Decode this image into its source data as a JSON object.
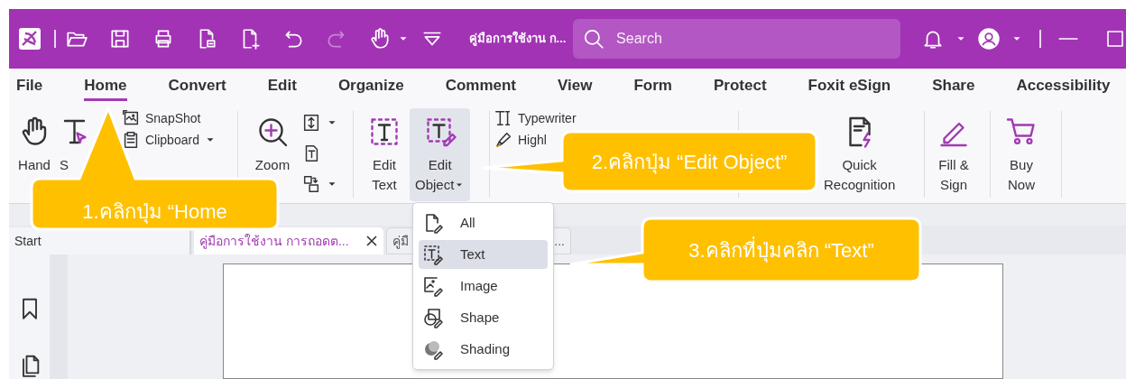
{
  "title_bar": {
    "quick_access": [
      {
        "kind": "logo",
        "disabled": false
      },
      {
        "kind": "open",
        "disabled": false
      },
      {
        "kind": "save",
        "disabled": false
      },
      {
        "kind": "print",
        "disabled": false
      },
      {
        "kind": "export",
        "disabled": false
      },
      {
        "kind": "new",
        "disabled": false
      },
      {
        "kind": "undo",
        "disabled": false
      },
      {
        "kind": "redo",
        "disabled": true
      },
      {
        "kind": "hand",
        "disabled": false
      },
      {
        "kind": "dropdown",
        "disabled": false
      },
      {
        "kind": "customize",
        "disabled": false
      }
    ],
    "document_title": "คู่มือการใช้งาน ก...",
    "search": {
      "placeholder": "Search"
    },
    "controls": [
      {
        "kind": "bell"
      },
      {
        "kind": "dropdown"
      },
      {
        "kind": "account"
      },
      {
        "kind": "dropdown"
      },
      {
        "kind": "separator"
      },
      {
        "kind": "minimize"
      },
      {
        "kind": "maximize"
      }
    ]
  },
  "menu": [
    {
      "label": "File",
      "selected": false
    },
    {
      "label": "Home",
      "selected": true
    },
    {
      "label": "Convert",
      "selected": false
    },
    {
      "label": "Edit",
      "selected": false
    },
    {
      "label": "Organize",
      "selected": false
    },
    {
      "label": "Comment",
      "selected": false
    },
    {
      "label": "View",
      "selected": false
    },
    {
      "label": "Form",
      "selected": false
    },
    {
      "label": "Protect",
      "selected": false
    },
    {
      "label": "Foxit eSign",
      "selected": false
    },
    {
      "label": "Share",
      "selected": false
    },
    {
      "label": "Accessibility",
      "selected": false
    }
  ],
  "ribbon": [
    {
      "tools": [
        {
          "kind": "hand",
          "lines": [
            "Hand"
          ],
          "dropdown": false,
          "selected": false
        },
        {
          "kind": "select",
          "lines": [
            "S"
          ],
          "dropdown": false,
          "selected": false
        },
        {
          "kind": "stack",
          "rows": [
            {
              "kind": "snapshot",
              "label": "SnapShot",
              "dropdown": false
            },
            {
              "kind": "clipboard",
              "label": "Clipboard",
              "dropdown": true
            }
          ]
        }
      ]
    },
    {
      "tools": [
        {
          "kind": "zoom",
          "lines": [
            "Zoom"
          ],
          "dropdown": false,
          "selected": false
        },
        {
          "kind": "stack",
          "rows": [
            {
              "kind": "fit-page",
              "dropdown": true
            },
            {
              "kind": "fit-width",
              "dropdown": false
            },
            {
              "kind": "rotate",
              "dropdown": true
            }
          ]
        }
      ]
    },
    {
      "tools": [
        {
          "kind": "edit-text",
          "lines": [
            "Edit",
            "Text"
          ],
          "dropdown": false,
          "selected": false
        },
        {
          "kind": "edit-object",
          "lines": [
            "Edit",
            "Object"
          ],
          "dropdown": true,
          "selected": true
        }
      ]
    },
    {
      "tools": [
        {
          "kind": "stack",
          "rows": [
            {
              "kind": "typewriter",
              "label": "Typewriter",
              "dropdown": false
            },
            {
              "kind": "highlight",
              "label": "Highl",
              "dropdown": false
            }
          ]
        }
      ]
    },
    {
      "tools": [
        {
          "kind": "ocr",
          "lines": [
            "Quick",
            "Recognition"
          ],
          "dropdown": false,
          "selected": false
        }
      ]
    },
    {
      "tools": [
        {
          "kind": "fill-sign",
          "lines": [
            "Fill &",
            "Sign"
          ],
          "dropdown": false,
          "selected": false
        }
      ]
    },
    {
      "tools": [
        {
          "kind": "cart",
          "lines": [
            "Buy",
            "Now"
          ],
          "dropdown": false,
          "selected": false
        }
      ]
    }
  ],
  "tabs": [
    {
      "label": "Start",
      "selected": false,
      "close": false
    },
    {
      "label": "คู่มือการใช้งาน การถอดต...",
      "selected": true,
      "close": true
    },
    {
      "label": "คู่มื",
      "tail": "...",
      "selected": false,
      "close": false
    }
  ],
  "sidebar": [
    {
      "kind": "bookmark"
    },
    {
      "kind": "pages"
    }
  ],
  "dropdown_menu": [
    {
      "kind": "all",
      "label": "All",
      "selected": false
    },
    {
      "kind": "text",
      "label": "Text",
      "selected": true
    },
    {
      "kind": "image",
      "label": "Image",
      "selected": false
    },
    {
      "kind": "shape",
      "label": "Shape",
      "selected": false
    },
    {
      "kind": "shading",
      "label": "Shading",
      "selected": false
    }
  ],
  "callouts": [
    {
      "text": "1.คลิกปุ่ม “Home"
    },
    {
      "text": "2.คลิกปุ่ม “Edit Object”"
    },
    {
      "text": "3.คลิกที่ปุ่มคลิก “Text”"
    }
  ]
}
